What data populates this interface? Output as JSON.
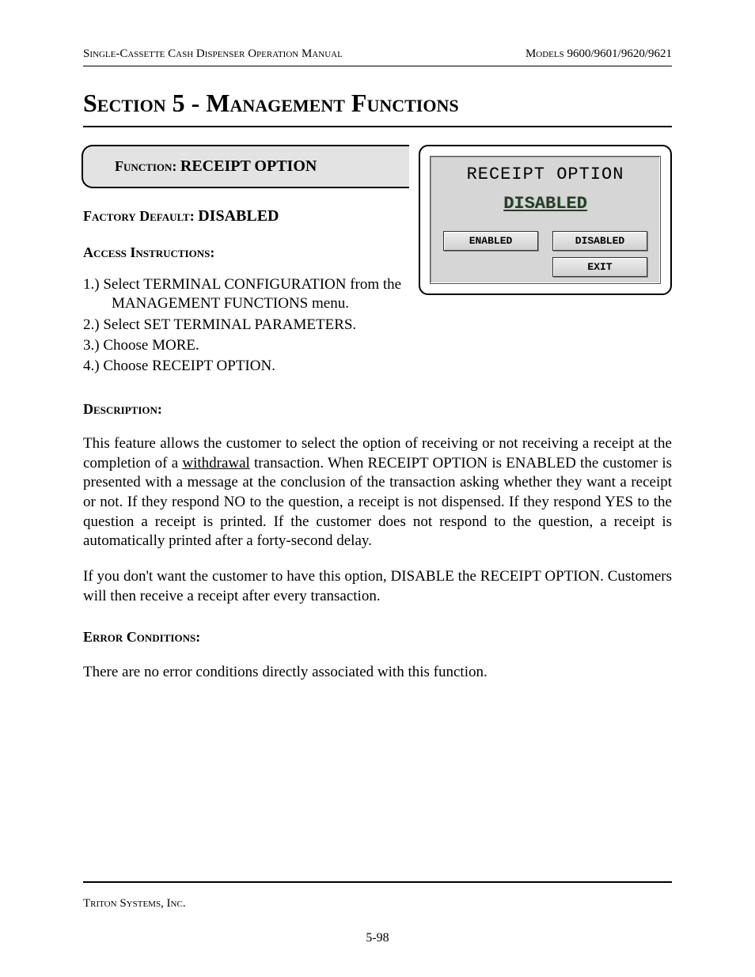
{
  "header": {
    "left": "Single-Cassette Cash Dispenser Operation Manual",
    "right": "Models 9600/9601/9620/9621"
  },
  "section_title": "Section 5 - Management Functions",
  "function_block": {
    "label": "Function:  ",
    "name": "RECEIPT OPTION"
  },
  "factory_default": {
    "label": "Factory Default: ",
    "value": "DISABLED"
  },
  "access_label": "Access Instructions:",
  "steps": [
    "1.)  Select TERMINAL CONFIGURATION from the MANAGEMENT FUNCTIONS menu.",
    "2.)  Select SET TERMINAL PARAMETERS.",
    "3.)  Choose MORE.",
    "4.)  Choose RECEIPT OPTION."
  ],
  "screen": {
    "title": "RECEIPT OPTION",
    "status": "DISABLED",
    "buttons": {
      "left": [
        "ENABLED"
      ],
      "right": [
        "DISABLED",
        "EXIT"
      ]
    }
  },
  "description_label": "Description:",
  "description_p1_a": "This feature allows the customer to select the option of receiving or not receiving a receipt at the completion of a ",
  "description_p1_u": "withdrawal",
  "description_p1_b": " transaction. When RECEIPT OPTION is ENABLED the customer is presented with a message at the conclusion of the transaction asking whether they want a receipt or not.  If they respond NO to the question, a receipt is not dispensed.  If they respond YES to the question a receipt is printed.  If the customer does not respond to the question, a receipt is automatically printed after a forty-second delay.",
  "description_p2": "If you don't want the customer to have this option, DISABLE the RECEIPT OPTION. Customers will then receive a receipt after every transaction.",
  "error_label": "Error Conditions:",
  "error_text": "There are no error conditions directly associated with this function.",
  "footer": {
    "company": "Triton Systems, Inc.",
    "page": "5-98"
  }
}
